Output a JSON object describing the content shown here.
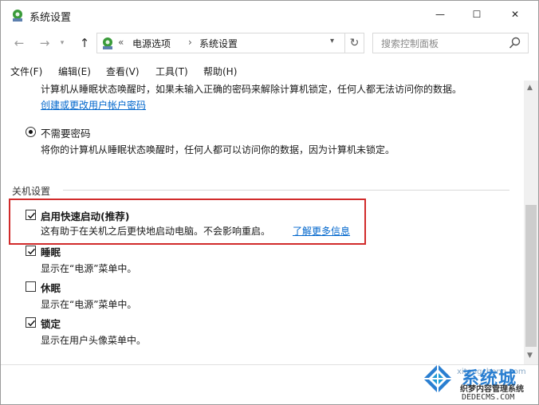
{
  "window": {
    "title": "系统设置",
    "controls": {
      "minimize": "—",
      "maximize": "☐",
      "close": "✕"
    }
  },
  "nav": {
    "back": "←",
    "forward": "→",
    "up": "↑",
    "breadcrumb_sep": "«",
    "crumb_sep": "›",
    "crumbs": [
      "电源选项",
      "系统设置"
    ],
    "refresh": "↻",
    "search_placeholder": "搜索控制面板"
  },
  "menu": [
    "文件(F)",
    "编辑(E)",
    "查看(V)",
    "工具(T)",
    "帮助(H)"
  ],
  "password": {
    "require_desc": "计算机从睡眠状态唤醒时，如果未输入正确的密码来解除计算机锁定，任何人都无法访问你的数据。",
    "create_link": "创建或更改用户帐户密码",
    "no_password_label": "不需要密码",
    "no_password_desc": "将你的计算机从睡眠状态唤醒时，任何人都可以访问你的数据，因为计算机未锁定。"
  },
  "shutdown": {
    "section_title": "关机设置",
    "options": [
      {
        "label": "启用快速启动(推荐)",
        "desc": "这有助于在关机之后更快地启动电脑。不会影响重启。",
        "link": "了解更多信息",
        "checked": true
      },
      {
        "label": "睡眠",
        "desc": "显示在“电源”菜单中。",
        "checked": true
      },
      {
        "label": "休眠",
        "desc": "显示在“电源”菜单中。",
        "checked": false
      },
      {
        "label": "锁定",
        "desc": "显示在用户头像菜单中。",
        "checked": true
      }
    ]
  },
  "watermark": {
    "brand": "系统城",
    "latin": "xitongcheng.com",
    "sub": "织梦内容管理系统",
    "site": "DEDECMS.COM"
  },
  "colors": {
    "link": "#0066cc",
    "highlight": "#d12b2b",
    "brand": "#2a7fd1"
  }
}
